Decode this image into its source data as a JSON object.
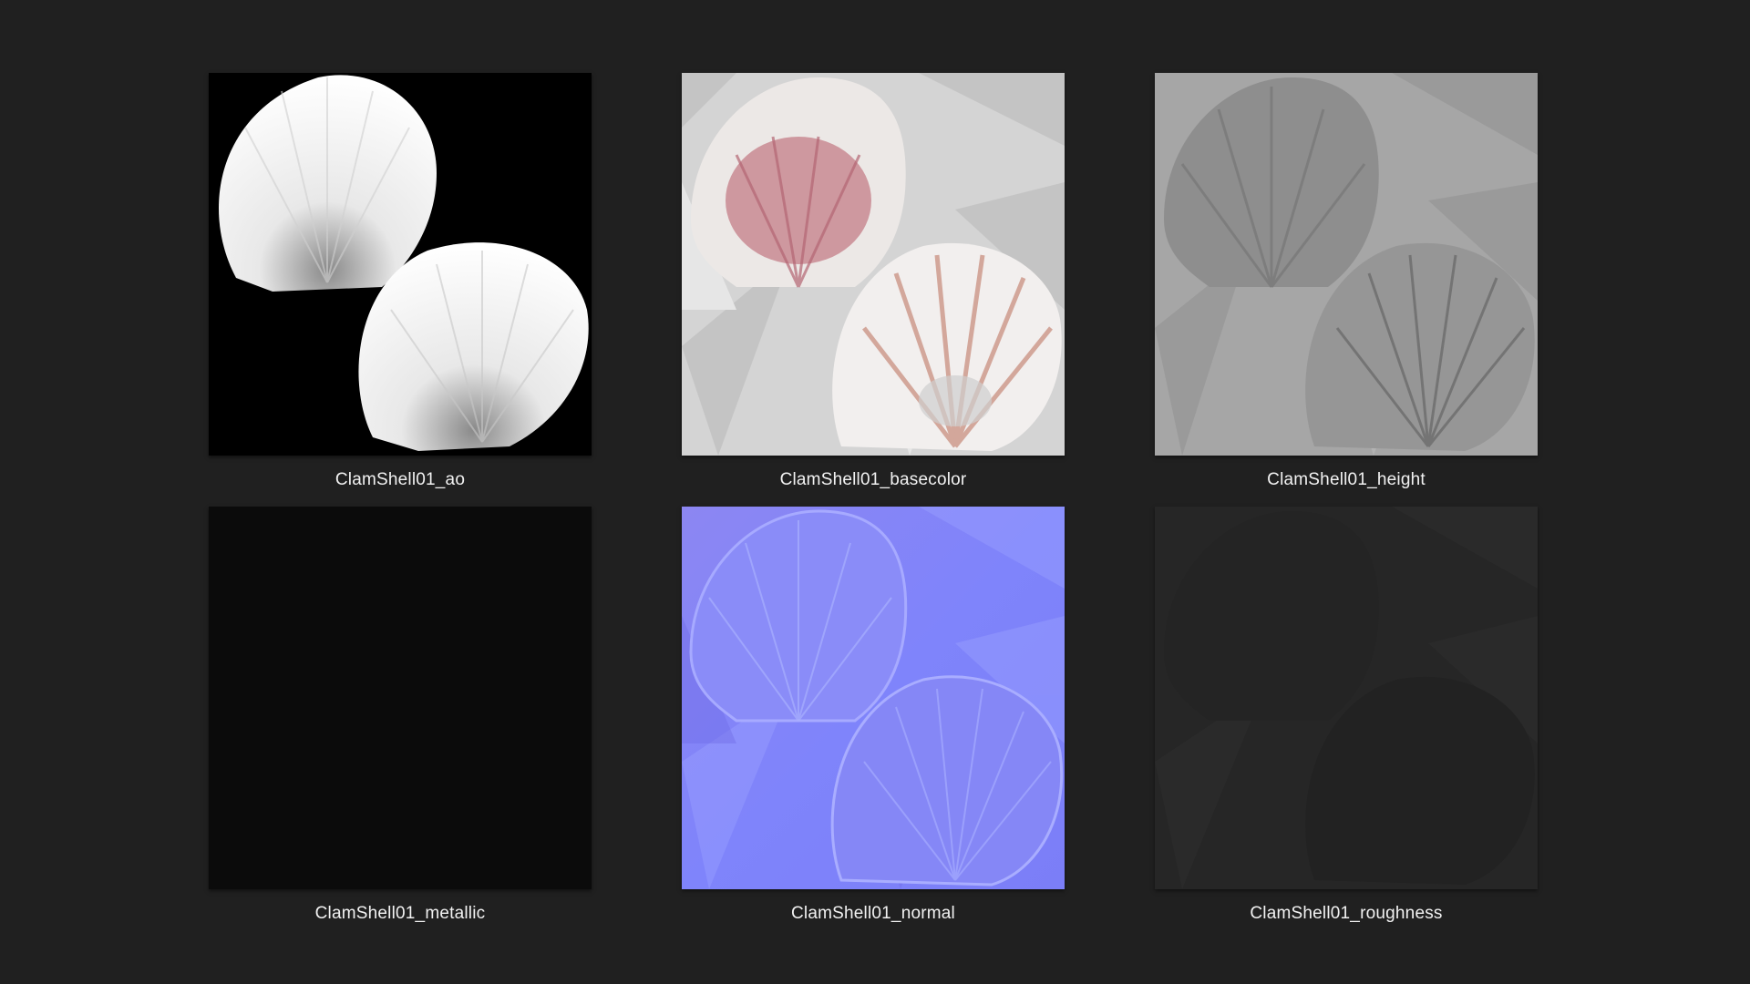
{
  "files": [
    {
      "name": "ClamShell01_ao"
    },
    {
      "name": "ClamShell01_basecolor"
    },
    {
      "name": "ClamShell01_height"
    },
    {
      "name": "ClamShell01_metallic"
    },
    {
      "name": "ClamShell01_normal"
    },
    {
      "name": "ClamShell01_roughness"
    }
  ],
  "colors": {
    "background": "#202020",
    "label": "#f2f2f2",
    "metallic": "#0b0b0b",
    "normal": "#8080ff",
    "roughness": "#262626"
  }
}
